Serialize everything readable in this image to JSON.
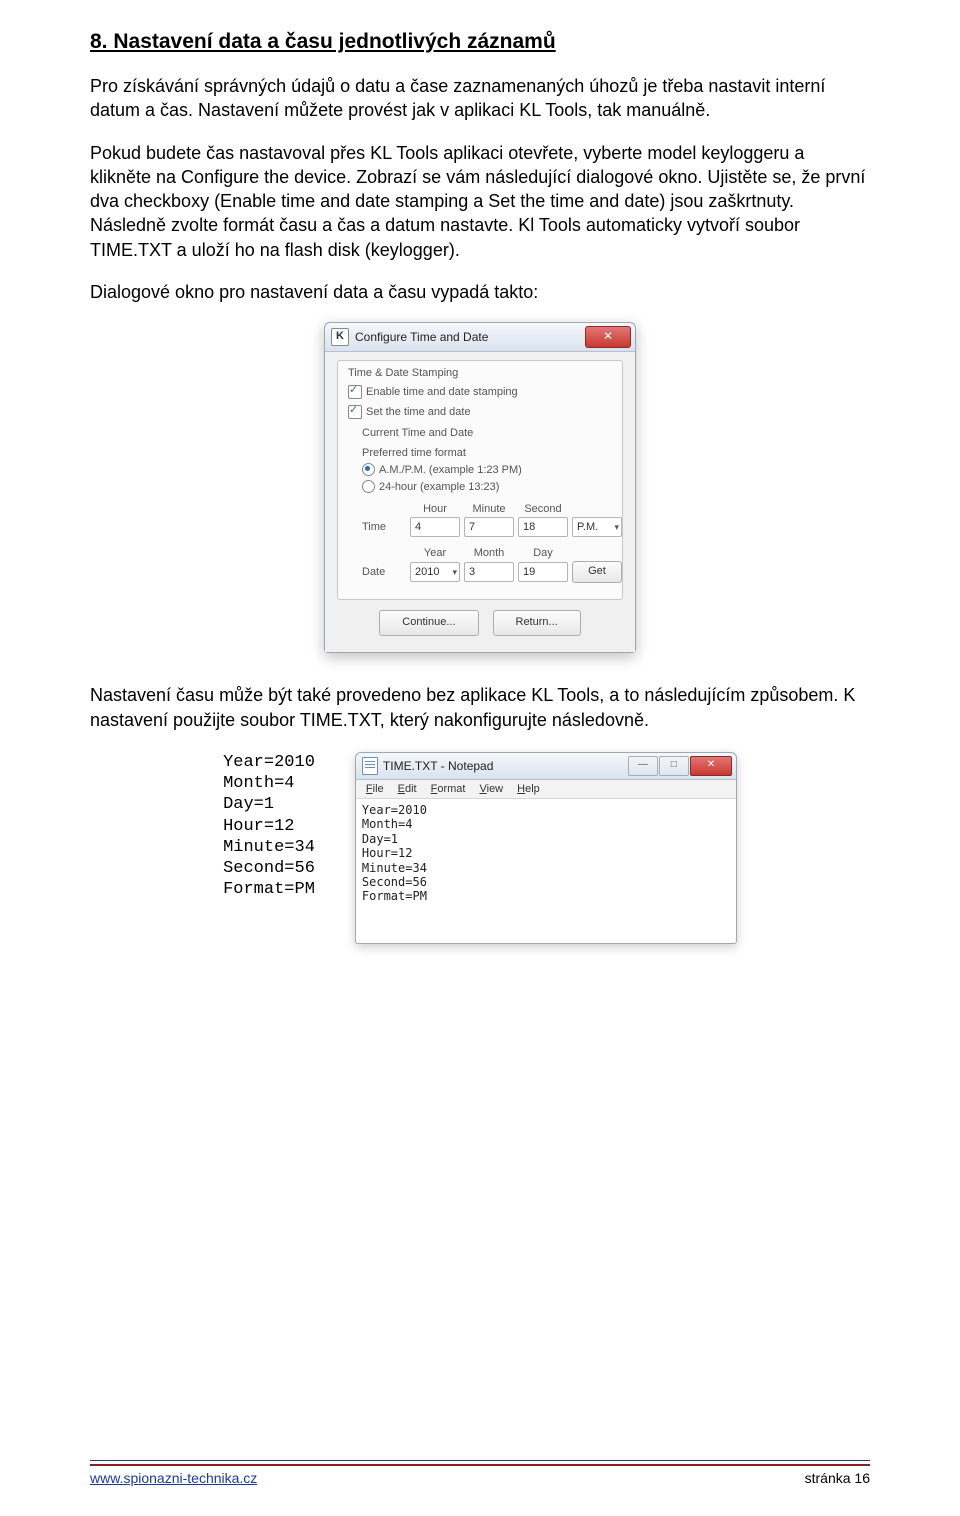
{
  "heading": "8.  Nastavení data a času jednotlivých záznamů",
  "para1": "Pro získávání správných údajů o datu a čase zaznamenaných úhozů je třeba nastavit interní datum a čas. Nastavení můžete provést jak v aplikaci KL Tools, tak manuálně.",
  "para2": "Pokud budete čas nastavoval přes KL Tools aplikaci otevřete, vyberte model keyloggeru a klikněte na Configure the device. Zobrazí se vám následující dialogové okno. Ujistěte se, že první dva checkboxy (Enable time and date stamping a Set the time and date) jsou zaškrtnuty. Následně zvolte formát času a čas a datum nastavte. Kl Tools automaticky vytvoří soubor TIME.TXT a uloží ho na flash disk (keylogger).",
  "para3": "Dialogové okno pro nastavení data a času vypadá takto:",
  "dialog": {
    "icon_letter": "K",
    "title": "Configure Time and Date",
    "close_glyph": "✕",
    "legend": "Time & Date Stamping",
    "cb1_label": "Enable time and date stamping",
    "cb2_label": "Set the time and date",
    "current_label": "Current Time and Date",
    "format_label": "Preferred time format",
    "radio1_label": "A.M./P.M. (example 1:23 PM)",
    "radio2_label": "24-hour (example 13:23)",
    "hdr_hour": "Hour",
    "hdr_minute": "Minute",
    "hdr_second": "Second",
    "row_time": "Time",
    "time_hour": "4",
    "time_minute": "7",
    "time_second": "18",
    "time_ampm": "P.M.",
    "hdr_year": "Year",
    "hdr_month": "Month",
    "hdr_day": "Day",
    "row_date": "Date",
    "date_year": "2010",
    "date_month": "3",
    "date_day": "19",
    "get_label": "Get",
    "continue_label": "Continue...",
    "return_label": "Return..."
  },
  "para4": "Nastavení času může být také provedeno bez aplikace KL Tools, a to následujícím způsobem. K nastavení použijte soubor TIME.TXT, který nakonfigurujte následovně.",
  "plain_lines": "Year=2010\nMonth=4\nDay=1\nHour=12\nMinute=34\nSecond=56\nFormat=PM",
  "notepad": {
    "title": "TIME.TXT - Notepad",
    "min_glyph": "—",
    "max_glyph": "□",
    "close_glyph": "✕",
    "menu_file": "File",
    "menu_edit": "Edit",
    "menu_format": "Format",
    "menu_view": "View",
    "menu_help": "Help",
    "body": "Year=2010\nMonth=4\nDay=1\nHour=12\nMinute=34\nSecond=56\nFormat=PM"
  },
  "footer": {
    "link": "www.spionazni-technika.cz",
    "page": "stránka 16"
  }
}
